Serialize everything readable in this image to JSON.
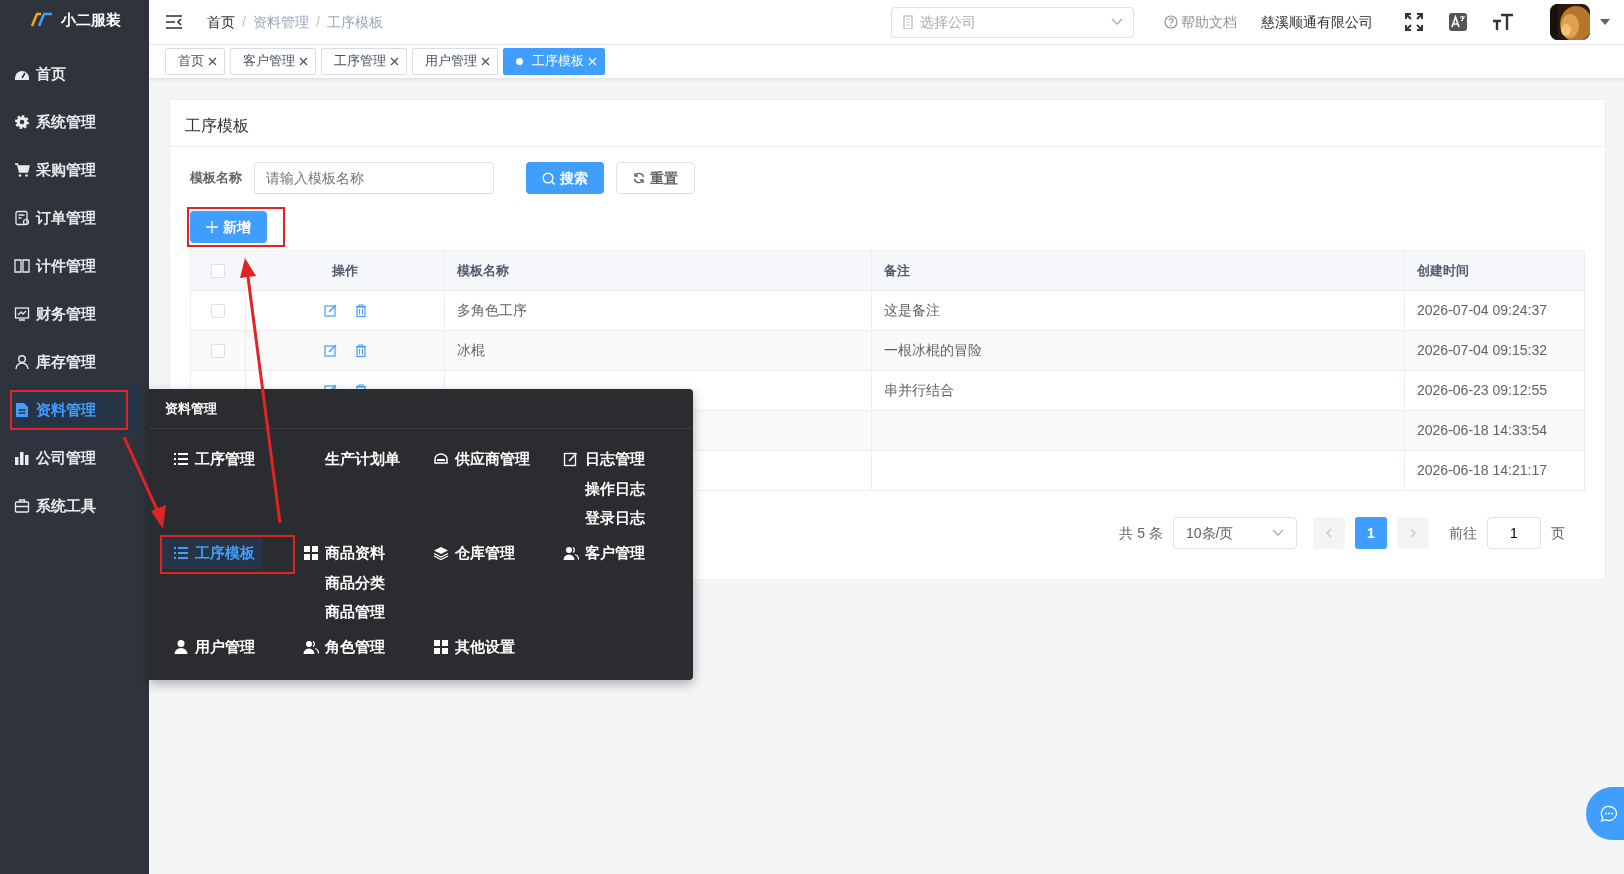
{
  "brand": {
    "name": "小二服装"
  },
  "header": {
    "breadcrumb": [
      {
        "label": "首页"
      },
      {
        "label": "资料管理",
        "separator": "/"
      },
      {
        "label": "工序模板",
        "separator": "/"
      }
    ],
    "company_select": {
      "placeholder": "选择公司"
    },
    "help": "帮助文档",
    "company": "慈溪顺通有限公司"
  },
  "tabs": [
    {
      "label": "首页",
      "selected": false
    },
    {
      "label": "客户管理",
      "selected": false
    },
    {
      "label": "工序管理",
      "selected": false
    },
    {
      "label": "用户管理",
      "selected": false
    },
    {
      "label": "工序模板",
      "selected": true
    }
  ],
  "sidebar": {
    "items": [
      {
        "label": "首页",
        "selected": false
      },
      {
        "label": "系统管理",
        "selected": false
      },
      {
        "label": "采购管理",
        "selected": false
      },
      {
        "label": "订单管理",
        "selected": false
      },
      {
        "label": "计件管理",
        "selected": false
      },
      {
        "label": "财务管理",
        "selected": false
      },
      {
        "label": "库存管理",
        "selected": false
      },
      {
        "label": "资料管理",
        "selected": true
      },
      {
        "label": "公司管理",
        "selected": false
      },
      {
        "label": "系统工具",
        "selected": false
      }
    ]
  },
  "submenu": {
    "title": "资料管理",
    "groups": [
      {
        "label": "工序管理",
        "selected": false
      },
      {
        "label": "生产计划单",
        "selected": false
      },
      {
        "label": "供应商管理",
        "selected": false
      },
      {
        "label": "日志管理",
        "selected": false,
        "children": [
          {
            "label": "操作日志"
          },
          {
            "label": "登录日志"
          }
        ]
      },
      {
        "label": "工序模板",
        "selected": true
      },
      {
        "label": "商品资料",
        "selected": false,
        "children": [
          {
            "label": "商品分类"
          },
          {
            "label": "商品管理"
          }
        ]
      },
      {
        "label": "仓库管理",
        "selected": false
      },
      {
        "label": "客户管理",
        "selected": false
      },
      {
        "label": "用户管理",
        "selected": false
      },
      {
        "label": "角色管理",
        "selected": false
      },
      {
        "label": "其他设置",
        "selected": false
      }
    ]
  },
  "page": {
    "title": "工序模板",
    "search": {
      "label": "模板名称",
      "placeholder": "请输入模板名称"
    },
    "search_button": "搜索",
    "reset_button": "重置",
    "add_button": "新增"
  },
  "table": {
    "all_checked": false,
    "columns": [
      "操作",
      "模板名称",
      "备注",
      "创建时间"
    ],
    "rows": [
      {
        "checked": false,
        "name": "多角色工序",
        "remark": "这是备注",
        "created": "2026-07-04 09:24:37"
      },
      {
        "checked": false,
        "name": "冰棍",
        "remark": "一根冰棍的冒险",
        "created": "2026-07-04 09:15:32"
      },
      {
        "remark": "串并行结合",
        "created": "2026-06-23 09:12:55"
      },
      {
        "created": "2026-06-18 14:33:54"
      },
      {
        "created": "2026-06-18 14:21:17"
      }
    ]
  },
  "pagination": {
    "total": "共 5 条",
    "page_size": "10条/页",
    "pages": [
      {
        "label": "1",
        "selected": true
      }
    ],
    "goto_label": "前往",
    "goto_value": "1",
    "goto_suffix": "页"
  }
}
